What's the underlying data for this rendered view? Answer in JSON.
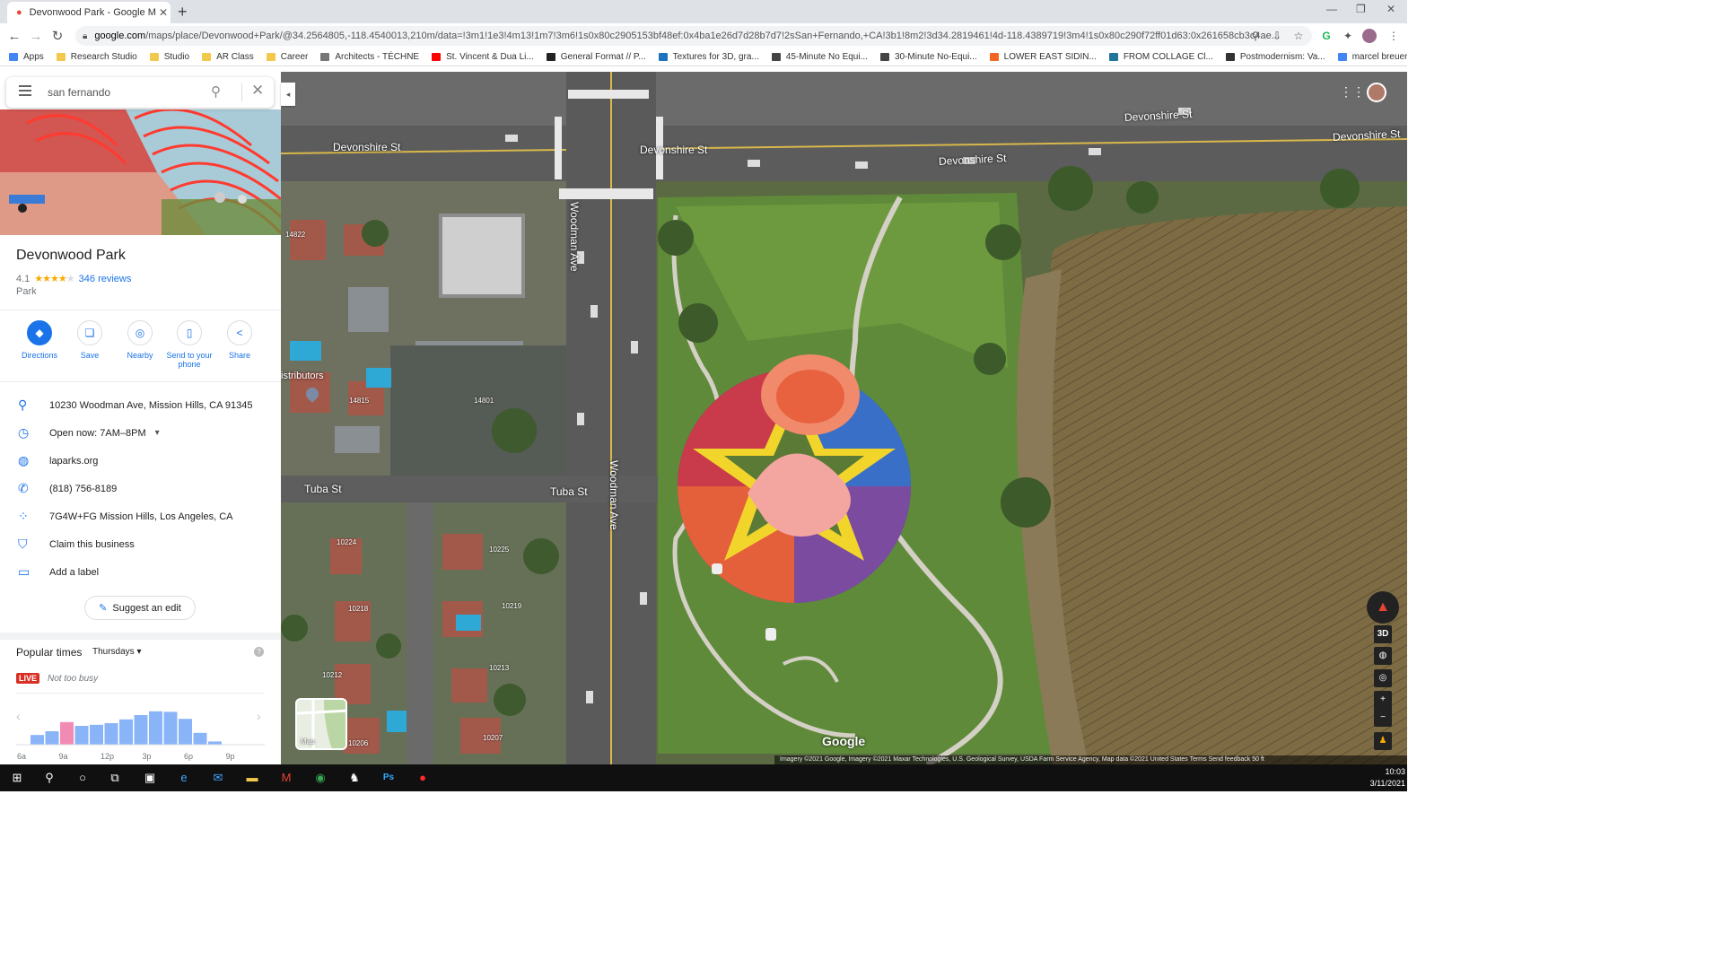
{
  "browser": {
    "tab_title": "Devonwood Park - Google Maps",
    "url_host": "google.com",
    "url_path": "/maps/place/Devonwood+Park/@34.2564805,-118.4540013,210m/data=!3m1!1e3!4m13!1m7!3m6!1s0x80c2905153bf48ef:0x4ba1e26d7d28b7d7!2sSan+Fernando,+CA!3b1!8m2!3d34.2819461!4d-118.4389719!3m4!1s0x80c290f72ff01d63:0x261658cb3c4ae..."
  },
  "bookmarks": [
    {
      "label": "Apps",
      "color": "#4285f4"
    },
    {
      "label": "Research Studio",
      "color": "#f2c94c"
    },
    {
      "label": "Studio",
      "color": "#f2c94c"
    },
    {
      "label": "AR Class",
      "color": "#f2c94c"
    },
    {
      "label": "Career",
      "color": "#f2c94c"
    },
    {
      "label": "Architects - TÉCHNE",
      "color": "#777777"
    },
    {
      "label": "St. Vincent & Dua Li...",
      "color": "#ff0000"
    },
    {
      "label": "General Format // P...",
      "color": "#222222"
    },
    {
      "label": "Textures for 3D, gra...",
      "color": "#1e73be"
    },
    {
      "label": "45-Minute No Equi...",
      "color": "#444444"
    },
    {
      "label": "30-Minute No-Equi...",
      "color": "#444444"
    },
    {
      "label": "LOWER EAST SIDIN...",
      "color": "#f26522"
    },
    {
      "label": "FROM COLLAGE Cl...",
      "color": "#21759b"
    },
    {
      "label": "Postmodernism: Va...",
      "color": "#333333"
    },
    {
      "label": "marcel breuer build...",
      "color": "#4285f4"
    }
  ],
  "search": {
    "value": "san fernando"
  },
  "place": {
    "name": "Devonwood Park",
    "rating": "4.1",
    "stars_filled": 4,
    "reviews": "346 reviews",
    "type": "Park"
  },
  "actions": [
    {
      "label": "Directions",
      "icon": "directions-icon"
    },
    {
      "label": "Save",
      "icon": "bookmark-icon"
    },
    {
      "label": "Nearby",
      "icon": "nearby-icon"
    },
    {
      "label": "Send to your phone",
      "icon": "phone-send-icon"
    },
    {
      "label": "Share",
      "icon": "share-icon"
    }
  ],
  "info": {
    "address": "10230 Woodman Ave, Mission Hills, CA 91345",
    "hours": "Open now:  7AM–8PM",
    "website": "laparks.org",
    "phone": "(818) 756-8189",
    "plus_code": "7G4W+FG Mission Hills, Los Angeles, CA",
    "claim": "Claim this business",
    "label": "Add a label"
  },
  "suggest_edit": "Suggest an edit",
  "popular_times": {
    "title": "Popular times",
    "day": "Thursdays",
    "live": "LIVE",
    "status": "Not too busy",
    "hours": [
      "6a",
      "9a",
      "12p",
      "3p",
      "6p",
      "9p"
    ]
  },
  "chart_data": {
    "type": "bar",
    "title": "Popular times",
    "categories": [
      "7a",
      "8a",
      "9a",
      "10a",
      "11a",
      "12p",
      "1p",
      "2p",
      "3p",
      "4p",
      "5p",
      "6p",
      "7p"
    ],
    "values": [
      18,
      25,
      42,
      35,
      37,
      40,
      47,
      55,
      62,
      61,
      48,
      22,
      6
    ],
    "ylim": [
      0,
      100
    ],
    "highlight_index": 2,
    "colors": {
      "bar": "#8ab4f8",
      "live": "#f28bb4"
    }
  },
  "map": {
    "streets": {
      "devonshire": "Devonshire St",
      "woodman": "Woodman Ave",
      "tuba": "Tuba St"
    },
    "lot_numbers": [
      "14822",
      "14815",
      "14801",
      "10224",
      "10225",
      "10218",
      "10219",
      "10212",
      "10213",
      "10206",
      "10207"
    ],
    "partial_label": "istributors",
    "thumb_label": "Map",
    "logo": "Google",
    "attribution": "Imagery ©2021 Google, Imagery ©2021 Maxar Technologies, U.S. Geological Survey, USDA Farm Service Agency, Map data ©2021    United States    Terms    Send feedback    50 ft",
    "controls": {
      "three_d": "3D"
    }
  },
  "taskbar": {
    "time": "10:03",
    "date": "3/11/2021"
  }
}
